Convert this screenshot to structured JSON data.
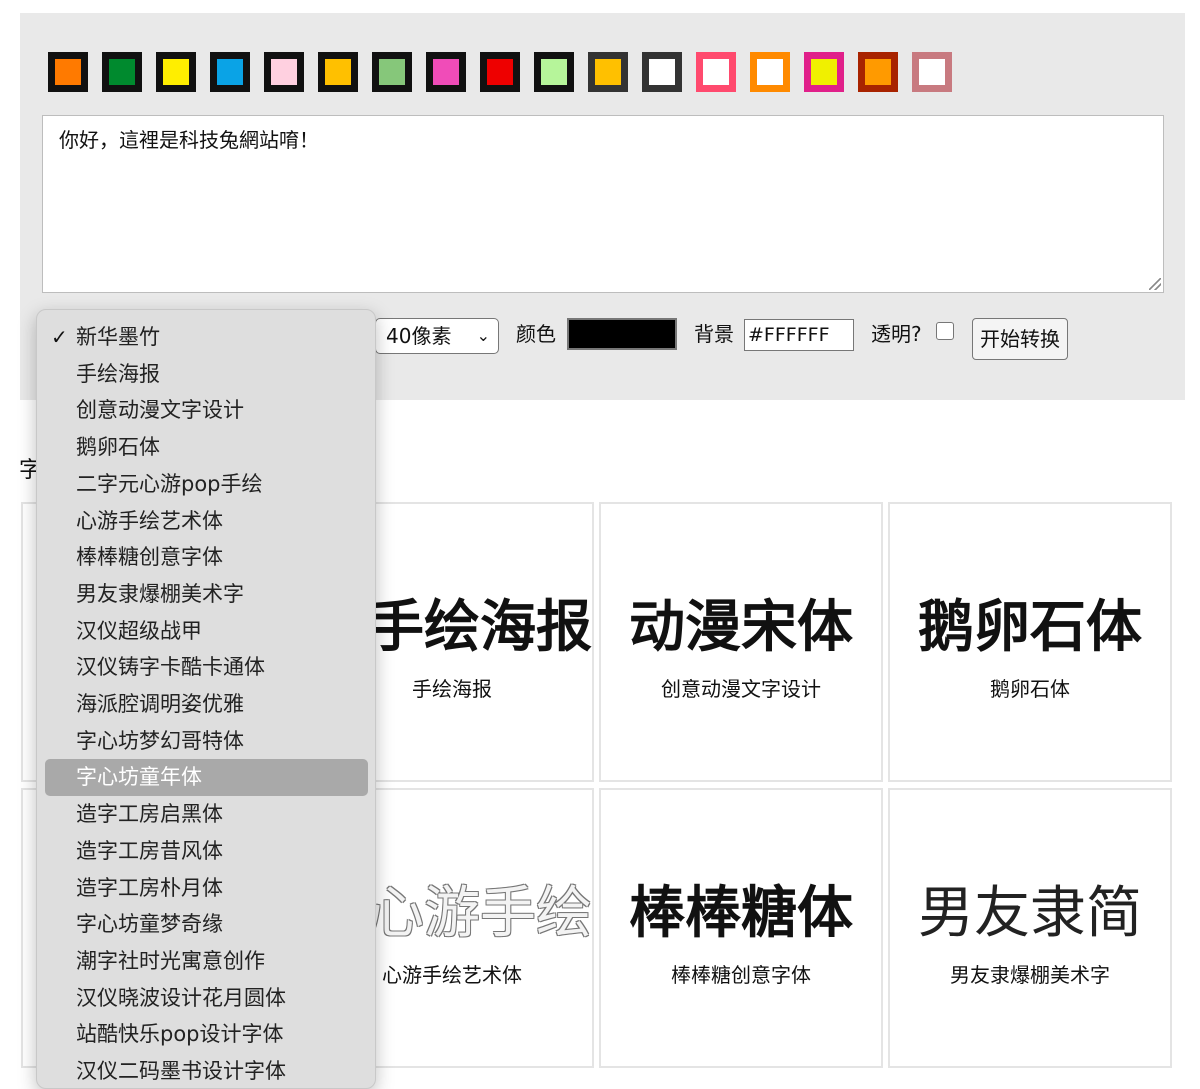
{
  "swatches": [
    {
      "name": "orange-swatch",
      "color": "#ff7a00"
    },
    {
      "name": "green-swatch",
      "color": "#008a2e"
    },
    {
      "name": "yellow-swatch",
      "color": "#ffee00"
    },
    {
      "name": "blue-swatch",
      "color": "#0aa3e6"
    },
    {
      "name": "pink-swatch",
      "color": "#ffd0e0"
    },
    {
      "name": "amber-swatch",
      "color": "#ffc000"
    },
    {
      "name": "light-green-swatch",
      "color": "#86c77a"
    },
    {
      "name": "magenta-swatch",
      "color": "#f04cb8"
    },
    {
      "name": "red-swatch",
      "color": "#ee0000"
    },
    {
      "name": "pale-green-swatch",
      "color": "#b6f59a"
    },
    {
      "name": "gold-on-dark-swatch",
      "color": "#ffc000",
      "border": "#333333"
    },
    {
      "name": "white-on-dark-swatch",
      "color": "#ffffff",
      "border": "#333333"
    },
    {
      "name": "white-on-rose-swatch",
      "color": "#ffffff",
      "border": "#ff4a6e"
    },
    {
      "name": "white-on-orange-swatch",
      "color": "#ffffff",
      "border": "#ff8a00"
    },
    {
      "name": "yellow-on-magenta-swatch",
      "color": "#f0f000",
      "border": "#e0208a"
    },
    {
      "name": "orange-on-brick-swatch",
      "color": "#ff9a00",
      "border": "#a82300"
    },
    {
      "name": "white-on-dusty-rose-swatch",
      "color": "#ffffff",
      "border": "#c87a80"
    }
  ],
  "textbox": {
    "value": "你好，這裡是科技兔網站唷！"
  },
  "controls": {
    "size_value": "40像素",
    "color_label": "颜色",
    "color_value": "#000000",
    "background_label": "背景",
    "background_value": "#FFFFFF",
    "transparent_label": "透明?",
    "transparent_checked": false,
    "convert_label": "开始转换"
  },
  "section_label": "字",
  "font_dropdown": {
    "selected": "新华墨竹",
    "highlighted": "字心坊童年体",
    "options": [
      "新华墨竹",
      "手绘海报",
      "创意动漫文字设计",
      "鹅卵石体",
      "二字元心游pop手绘",
      "心游手绘艺术体",
      "棒棒糖创意字体",
      "男友隶爆棚美术字",
      "汉仪超级战甲",
      "汉仪铸字卡酷卡通体",
      "海派腔调明姿优雅",
      "字心坊梦幻哥特体",
      "字心坊童年体",
      "造字工房启黑体",
      "造字工房昔风体",
      "造字工房朴月体",
      "字心坊童梦奇缘",
      "潮字社时光寓意创作",
      "汉仪晓波设计花月圆体",
      "站酷快乐pop设计字体",
      "汉仪二码墨书设计字体"
    ]
  },
  "font_cards": [
    {
      "preview": "手绘海报",
      "caption": "手绘海报",
      "style": "cut"
    },
    {
      "preview": "动漫宋体",
      "caption": "创意动漫文字设计",
      "style": "bold"
    },
    {
      "preview": "鹅卵石体",
      "caption": "鹅卵石体",
      "style": "bold"
    },
    {
      "preview": "心游手绘",
      "caption": "心游手绘艺术体",
      "style": "outline-cut"
    },
    {
      "preview": "棒棒糖体",
      "caption": "棒棒糖创意字体",
      "style": "bold"
    },
    {
      "preview": "男友隶简",
      "caption": "男友隶爆棚美术字",
      "style": "thin"
    }
  ]
}
